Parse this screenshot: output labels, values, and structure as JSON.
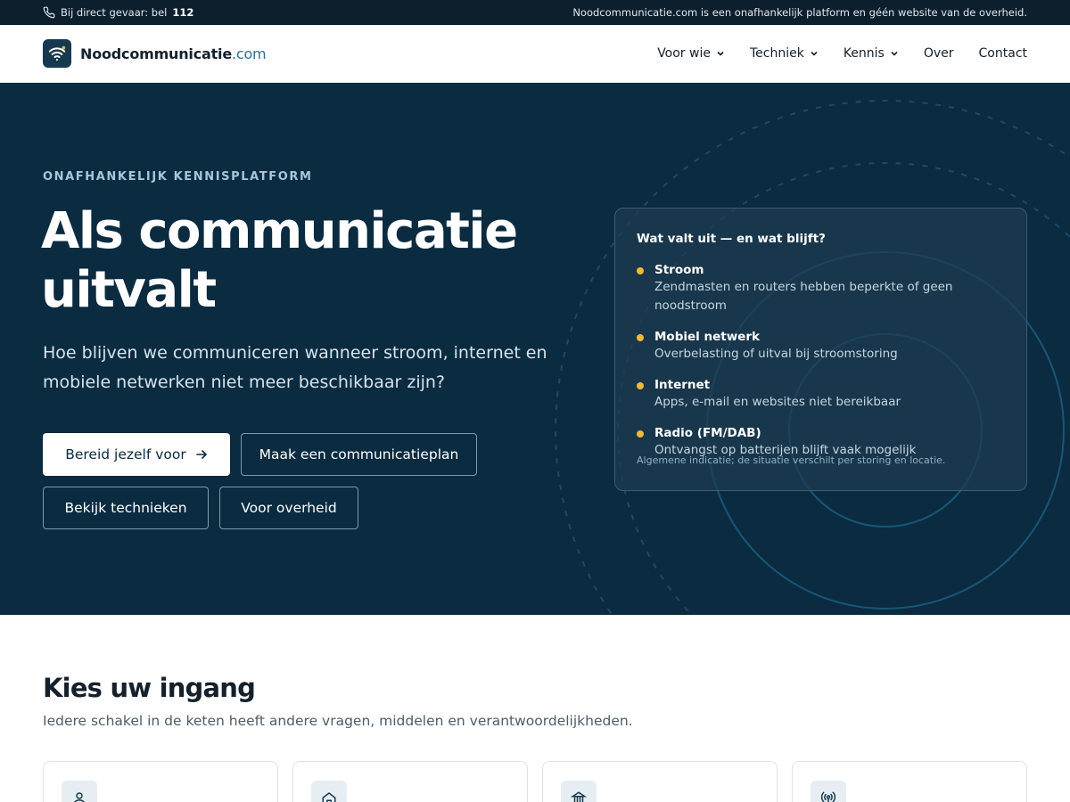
{
  "topbar": {
    "emergency_prefix": "Bij direct gevaar: bel",
    "emergency_number": "112",
    "disclaimer": "Noodcommunicatie.com is een onafhankelijk platform en géén website van de overheid."
  },
  "header": {
    "brand_main": "Noodcommunicatie",
    "brand_tld": ".com",
    "nav": [
      {
        "label": "Voor wie",
        "dropdown": true
      },
      {
        "label": "Techniek",
        "dropdown": true
      },
      {
        "label": "Kennis",
        "dropdown": true
      },
      {
        "label": "Over",
        "dropdown": false
      },
      {
        "label": "Contact",
        "dropdown": false
      }
    ]
  },
  "hero": {
    "eyebrow": "ONAFHANKELIJK KENNISPLATFORM",
    "title": "Als communicatie uitvalt",
    "subtitle": "Hoe blijven we communiceren wanneer stroom, internet en mobiele netwerken niet meer beschikbaar zijn?",
    "buttons": {
      "prepare": "Bereid jezelf voor",
      "plan": "Maak een communicatieplan",
      "techniques": "Bekijk technieken",
      "government": "Voor overheid"
    },
    "card": {
      "title": "Wat valt uit — en wat blijft?",
      "items": [
        {
          "label": "Stroom",
          "desc": "Zendmasten en routers hebben beperkte of geen noodstroom"
        },
        {
          "label": "Mobiel netwerk",
          "desc": "Overbelasting of uitval bij stroomstoring"
        },
        {
          "label": "Internet",
          "desc": "Apps, e-mail en websites niet bereikbaar"
        },
        {
          "label": "Radio (FM/DAB)",
          "desc": "Ontvangst op batterijen blijft vaak mogelijk"
        }
      ],
      "note": "Algemene indicatie; de situatie verschilt per storing en locatie."
    }
  },
  "entry_section": {
    "title": "Kies uw ingang",
    "subtitle": "Iedere schakel in de keten heeft andere vragen, middelen en verantwoordelijkheden.",
    "cards": [
      {
        "icon": "person-icon"
      },
      {
        "icon": "home-icon"
      },
      {
        "icon": "government-building-icon"
      },
      {
        "icon": "radio-antenna-icon"
      }
    ]
  },
  "colors": {
    "hero_bg": "#0b2b40",
    "topbar_bg": "#0d1e2c",
    "accent_dot": "#f0b93a",
    "brand_tld": "#2e6e91"
  }
}
